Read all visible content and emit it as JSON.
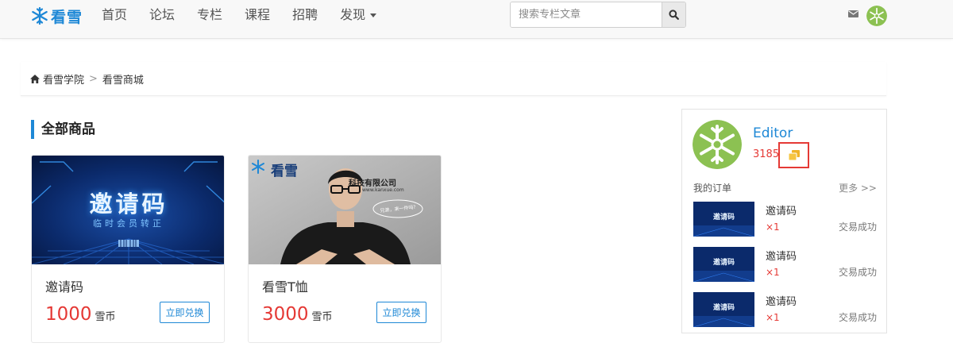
{
  "header": {
    "logo_text": "看雪",
    "nav": [
      "首页",
      "论坛",
      "专栏",
      "课程",
      "招聘"
    ],
    "nav_dropdown": "发现",
    "search_placeholder": "搜索专栏文章",
    "brand_color": "#1e88d6"
  },
  "breadcrumb": {
    "home": "看雪学院",
    "sep": ">",
    "current": "看雪商城"
  },
  "section": {
    "title": "全部商品"
  },
  "products": [
    {
      "name": "邀请码",
      "price": "1000",
      "unit": "雪币",
      "button": "立即兑换",
      "banner_title": "邀请码",
      "banner_subtitle": "临时会员转正"
    },
    {
      "name": "看雪T恤",
      "price": "3000",
      "unit": "雪币",
      "button": "立即兑换",
      "photo_logo": "看雪",
      "photo_text": "科技有限公司",
      "photo_url": "www.kanxue.com",
      "photo_bubble": "兄弟，来一件吗?"
    }
  ],
  "user": {
    "name": "Editor",
    "coins": "3185"
  },
  "orders": {
    "title": "我的订单",
    "more": "更多 >>",
    "thumb_label": "邀请码",
    "items": [
      {
        "name": "邀请码",
        "qty": "×1",
        "status": "交易成功"
      },
      {
        "name": "邀请码",
        "qty": "×1",
        "status": "交易成功"
      },
      {
        "name": "邀请码",
        "qty": "×1",
        "status": "交易成功"
      }
    ]
  },
  "icons": {
    "logo": "snowflake-logo-icon",
    "search": "search-icon",
    "mail": "mail-icon",
    "home": "home-icon",
    "coin": "coins-icon"
  },
  "colors": {
    "price": "#e53935",
    "accent": "#1e88d6",
    "highlight_box": "#e53935"
  }
}
